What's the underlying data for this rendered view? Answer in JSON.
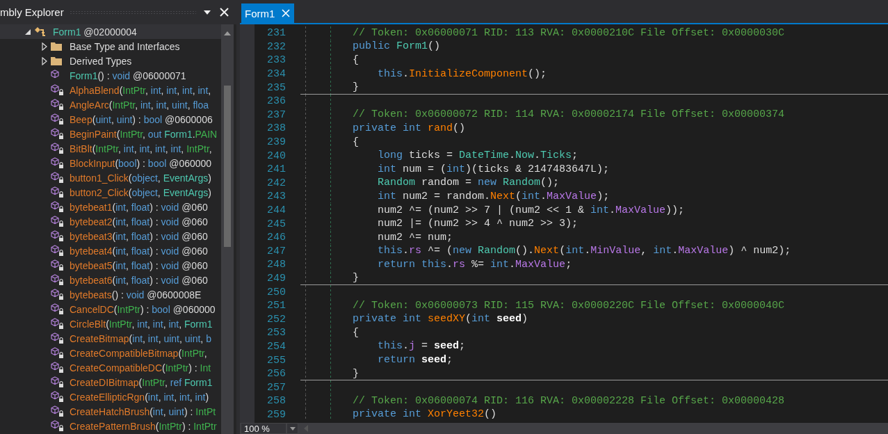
{
  "explorer": {
    "title": "mbly Explorer",
    "tree": [
      {
        "kind": "class",
        "expanded": true,
        "segments": [
          {
            "text": "Form1",
            "kind": "t"
          },
          {
            "text": " @02000004",
            "kind": "p"
          }
        ],
        "children": [
          {
            "kind": "folder",
            "expanded": false,
            "segments": [
              {
                "text": "Base Type and Interfaces",
                "kind": "p"
              }
            ]
          },
          {
            "kind": "folder",
            "expanded": false,
            "segments": [
              {
                "text": "Derived Types",
                "kind": "p"
              }
            ]
          },
          {
            "kind": "method",
            "locked": false,
            "segments": [
              {
                "text": "Form1",
                "kind": "t"
              },
              {
                "text": "() : ",
                "kind": "p"
              },
              {
                "text": "void",
                "kind": "k"
              },
              {
                "text": " @06000071",
                "kind": "p"
              }
            ]
          },
          {
            "kind": "method",
            "locked": true,
            "segments": [
              {
                "text": "AlphaBlend",
                "kind": "m"
              },
              {
                "text": "(",
                "kind": "p"
              },
              {
                "text": "IntPtr",
                "kind": "g"
              },
              {
                "text": ", ",
                "kind": "p"
              },
              {
                "text": "int",
                "kind": "k"
              },
              {
                "text": ", ",
                "kind": "p"
              },
              {
                "text": "int",
                "kind": "k"
              },
              {
                "text": ", ",
                "kind": "p"
              },
              {
                "text": "int",
                "kind": "k"
              },
              {
                "text": ", ",
                "kind": "p"
              },
              {
                "text": "int",
                "kind": "k"
              },
              {
                "text": ",",
                "kind": "p"
              }
            ]
          },
          {
            "kind": "method",
            "locked": true,
            "segments": [
              {
                "text": "AngleArc",
                "kind": "m"
              },
              {
                "text": "(",
                "kind": "p"
              },
              {
                "text": "IntPtr",
                "kind": "g"
              },
              {
                "text": ", ",
                "kind": "p"
              },
              {
                "text": "int",
                "kind": "k"
              },
              {
                "text": ", ",
                "kind": "p"
              },
              {
                "text": "int",
                "kind": "k"
              },
              {
                "text": ", ",
                "kind": "p"
              },
              {
                "text": "uint",
                "kind": "k"
              },
              {
                "text": ", ",
                "kind": "p"
              },
              {
                "text": "floa",
                "kind": "k"
              }
            ]
          },
          {
            "kind": "method",
            "locked": true,
            "segments": [
              {
                "text": "Beep",
                "kind": "m"
              },
              {
                "text": "(",
                "kind": "p"
              },
              {
                "text": "uint",
                "kind": "k"
              },
              {
                "text": ", ",
                "kind": "p"
              },
              {
                "text": "uint",
                "kind": "k"
              },
              {
                "text": ") : ",
                "kind": "p"
              },
              {
                "text": "bool",
                "kind": "k"
              },
              {
                "text": " @0600006",
                "kind": "p"
              }
            ]
          },
          {
            "kind": "method",
            "locked": true,
            "segments": [
              {
                "text": "BeginPaint",
                "kind": "m"
              },
              {
                "text": "(",
                "kind": "p"
              },
              {
                "text": "IntPtr",
                "kind": "g"
              },
              {
                "text": ", ",
                "kind": "p"
              },
              {
                "text": "out",
                "kind": "k"
              },
              {
                "text": " Form1",
                "kind": "t"
              },
              {
                "text": ".",
                "kind": "p"
              },
              {
                "text": "PAIN",
                "kind": "g"
              }
            ]
          },
          {
            "kind": "method",
            "locked": true,
            "segments": [
              {
                "text": "BitBlt",
                "kind": "m"
              },
              {
                "text": "(",
                "kind": "p"
              },
              {
                "text": "IntPtr",
                "kind": "g"
              },
              {
                "text": ", ",
                "kind": "p"
              },
              {
                "text": "int",
                "kind": "k"
              },
              {
                "text": ", ",
                "kind": "p"
              },
              {
                "text": "int",
                "kind": "k"
              },
              {
                "text": ", ",
                "kind": "p"
              },
              {
                "text": "int",
                "kind": "k"
              },
              {
                "text": ", ",
                "kind": "p"
              },
              {
                "text": "int",
                "kind": "k"
              },
              {
                "text": ", ",
                "kind": "p"
              },
              {
                "text": "IntPtr",
                "kind": "g"
              },
              {
                "text": ",",
                "kind": "p"
              }
            ]
          },
          {
            "kind": "method",
            "locked": true,
            "segments": [
              {
                "text": "BlockInput",
                "kind": "m"
              },
              {
                "text": "(",
                "kind": "p"
              },
              {
                "text": "bool",
                "kind": "k"
              },
              {
                "text": ") : ",
                "kind": "p"
              },
              {
                "text": "bool",
                "kind": "k"
              },
              {
                "text": " @060000",
                "kind": "p"
              }
            ]
          },
          {
            "kind": "method",
            "locked": true,
            "segments": [
              {
                "text": "button1_Click",
                "kind": "m"
              },
              {
                "text": "(",
                "kind": "p"
              },
              {
                "text": "object",
                "kind": "k"
              },
              {
                "text": ", ",
                "kind": "p"
              },
              {
                "text": "EventArgs",
                "kind": "t"
              },
              {
                "text": ")",
                "kind": "p"
              }
            ]
          },
          {
            "kind": "method",
            "locked": true,
            "segments": [
              {
                "text": "button2_Click",
                "kind": "m"
              },
              {
                "text": "(",
                "kind": "p"
              },
              {
                "text": "object",
                "kind": "k"
              },
              {
                "text": ", ",
                "kind": "p"
              },
              {
                "text": "EventArgs",
                "kind": "t"
              },
              {
                "text": ")",
                "kind": "p"
              }
            ]
          },
          {
            "kind": "method",
            "locked": true,
            "segments": [
              {
                "text": "bytebeat1",
                "kind": "m"
              },
              {
                "text": "(",
                "kind": "p"
              },
              {
                "text": "int",
                "kind": "k"
              },
              {
                "text": ", ",
                "kind": "p"
              },
              {
                "text": "float",
                "kind": "k"
              },
              {
                "text": ") : ",
                "kind": "p"
              },
              {
                "text": "void",
                "kind": "k"
              },
              {
                "text": " @060",
                "kind": "p"
              }
            ]
          },
          {
            "kind": "method",
            "locked": true,
            "segments": [
              {
                "text": "bytebeat2",
                "kind": "m"
              },
              {
                "text": "(",
                "kind": "p"
              },
              {
                "text": "int",
                "kind": "k"
              },
              {
                "text": ", ",
                "kind": "p"
              },
              {
                "text": "float",
                "kind": "k"
              },
              {
                "text": ") : ",
                "kind": "p"
              },
              {
                "text": "void",
                "kind": "k"
              },
              {
                "text": " @060",
                "kind": "p"
              }
            ]
          },
          {
            "kind": "method",
            "locked": true,
            "segments": [
              {
                "text": "bytebeat3",
                "kind": "m"
              },
              {
                "text": "(",
                "kind": "p"
              },
              {
                "text": "int",
                "kind": "k"
              },
              {
                "text": ", ",
                "kind": "p"
              },
              {
                "text": "float",
                "kind": "k"
              },
              {
                "text": ") : ",
                "kind": "p"
              },
              {
                "text": "void",
                "kind": "k"
              },
              {
                "text": " @060",
                "kind": "p"
              }
            ]
          },
          {
            "kind": "method",
            "locked": true,
            "segments": [
              {
                "text": "bytebeat4",
                "kind": "m"
              },
              {
                "text": "(",
                "kind": "p"
              },
              {
                "text": "int",
                "kind": "k"
              },
              {
                "text": ", ",
                "kind": "p"
              },
              {
                "text": "float",
                "kind": "k"
              },
              {
                "text": ") : ",
                "kind": "p"
              },
              {
                "text": "void",
                "kind": "k"
              },
              {
                "text": " @060",
                "kind": "p"
              }
            ]
          },
          {
            "kind": "method",
            "locked": true,
            "segments": [
              {
                "text": "bytebeat5",
                "kind": "m"
              },
              {
                "text": "(",
                "kind": "p"
              },
              {
                "text": "int",
                "kind": "k"
              },
              {
                "text": ", ",
                "kind": "p"
              },
              {
                "text": "float",
                "kind": "k"
              },
              {
                "text": ") : ",
                "kind": "p"
              },
              {
                "text": "void",
                "kind": "k"
              },
              {
                "text": " @060",
                "kind": "p"
              }
            ]
          },
          {
            "kind": "method",
            "locked": true,
            "segments": [
              {
                "text": "bytebeat6",
                "kind": "m"
              },
              {
                "text": "(",
                "kind": "p"
              },
              {
                "text": "int",
                "kind": "k"
              },
              {
                "text": ", ",
                "kind": "p"
              },
              {
                "text": "float",
                "kind": "k"
              },
              {
                "text": ") : ",
                "kind": "p"
              },
              {
                "text": "void",
                "kind": "k"
              },
              {
                "text": " @060",
                "kind": "p"
              }
            ]
          },
          {
            "kind": "method",
            "locked": true,
            "segments": [
              {
                "text": "bytebeats",
                "kind": "m"
              },
              {
                "text": "() : ",
                "kind": "p"
              },
              {
                "text": "void",
                "kind": "k"
              },
              {
                "text": " @0600008E",
                "kind": "p"
              }
            ]
          },
          {
            "kind": "method",
            "locked": true,
            "segments": [
              {
                "text": "CancelDC",
                "kind": "m"
              },
              {
                "text": "(",
                "kind": "p"
              },
              {
                "text": "IntPtr",
                "kind": "g"
              },
              {
                "text": ") : ",
                "kind": "p"
              },
              {
                "text": "bool",
                "kind": "k"
              },
              {
                "text": " @060000",
                "kind": "p"
              }
            ]
          },
          {
            "kind": "method",
            "locked": true,
            "segments": [
              {
                "text": "CircleBlt",
                "kind": "m"
              },
              {
                "text": "(",
                "kind": "p"
              },
              {
                "text": "IntPtr",
                "kind": "g"
              },
              {
                "text": ", ",
                "kind": "p"
              },
              {
                "text": "int",
                "kind": "k"
              },
              {
                "text": ", ",
                "kind": "p"
              },
              {
                "text": "int",
                "kind": "k"
              },
              {
                "text": ", ",
                "kind": "p"
              },
              {
                "text": "int",
                "kind": "k"
              },
              {
                "text": ", ",
                "kind": "p"
              },
              {
                "text": "Form1",
                "kind": "t"
              }
            ]
          },
          {
            "kind": "method",
            "locked": true,
            "segments": [
              {
                "text": "CreateBitmap",
                "kind": "m"
              },
              {
                "text": "(",
                "kind": "p"
              },
              {
                "text": "int",
                "kind": "k"
              },
              {
                "text": ", ",
                "kind": "p"
              },
              {
                "text": "int",
                "kind": "k"
              },
              {
                "text": ", ",
                "kind": "p"
              },
              {
                "text": "uint",
                "kind": "k"
              },
              {
                "text": ", ",
                "kind": "p"
              },
              {
                "text": "uint",
                "kind": "k"
              },
              {
                "text": ", ",
                "kind": "p"
              },
              {
                "text": "b",
                "kind": "k"
              }
            ]
          },
          {
            "kind": "method",
            "locked": true,
            "segments": [
              {
                "text": "CreateCompatibleBitmap",
                "kind": "m"
              },
              {
                "text": "(",
                "kind": "p"
              },
              {
                "text": "IntPtr",
                "kind": "g"
              },
              {
                "text": ",",
                "kind": "p"
              }
            ]
          },
          {
            "kind": "method",
            "locked": true,
            "segments": [
              {
                "text": "CreateCompatibleDC",
                "kind": "m"
              },
              {
                "text": "(",
                "kind": "p"
              },
              {
                "text": "IntPtr",
                "kind": "g"
              },
              {
                "text": ") : ",
                "kind": "p"
              },
              {
                "text": "Int",
                "kind": "g"
              }
            ]
          },
          {
            "kind": "method",
            "locked": true,
            "segments": [
              {
                "text": "CreateDIBitmap",
                "kind": "m"
              },
              {
                "text": "(",
                "kind": "p"
              },
              {
                "text": "IntPtr",
                "kind": "g"
              },
              {
                "text": ", ",
                "kind": "p"
              },
              {
                "text": "ref",
                "kind": "k"
              },
              {
                "text": " Form1",
                "kind": "t"
              }
            ]
          },
          {
            "kind": "method",
            "locked": true,
            "segments": [
              {
                "text": "CreateEllipticRgn",
                "kind": "m"
              },
              {
                "text": "(",
                "kind": "p"
              },
              {
                "text": "int",
                "kind": "k"
              },
              {
                "text": ", ",
                "kind": "p"
              },
              {
                "text": "int",
                "kind": "k"
              },
              {
                "text": ", ",
                "kind": "p"
              },
              {
                "text": "int",
                "kind": "k"
              },
              {
                "text": ", ",
                "kind": "p"
              },
              {
                "text": "int",
                "kind": "k"
              },
              {
                "text": ")",
                "kind": "p"
              }
            ]
          },
          {
            "kind": "method",
            "locked": true,
            "segments": [
              {
                "text": "CreateHatchBrush",
                "kind": "m"
              },
              {
                "text": "(",
                "kind": "p"
              },
              {
                "text": "int",
                "kind": "k"
              },
              {
                "text": ", ",
                "kind": "p"
              },
              {
                "text": "uint",
                "kind": "k"
              },
              {
                "text": ") : ",
                "kind": "p"
              },
              {
                "text": "IntPt",
                "kind": "g"
              }
            ]
          },
          {
            "kind": "method",
            "locked": true,
            "segments": [
              {
                "text": "CreatePatternBrush",
                "kind": "m"
              },
              {
                "text": "(",
                "kind": "p"
              },
              {
                "text": "IntPtr",
                "kind": "g"
              },
              {
                "text": ") : ",
                "kind": "p"
              },
              {
                "text": "IntPtr",
                "kind": "g"
              }
            ]
          }
        ]
      }
    ]
  },
  "editor": {
    "tabs": [
      {
        "label": "Form1",
        "selected": true
      }
    ],
    "lines": [
      {
        "number": "231",
        "tokens": [
          {
            "text": "// Token: 0x06000071 RID: 113 RVA: 0x0000210C File Offset: 0x0000030C",
            "kind": "c"
          }
        ]
      },
      {
        "number": "232",
        "tokens": [
          {
            "text": "public",
            "kind": "k"
          },
          {
            "text": " Form1",
            "kind": "t"
          },
          {
            "text": "()",
            "kind": "p"
          }
        ]
      },
      {
        "number": "233",
        "tokens": [
          {
            "text": "{",
            "kind": "p"
          }
        ]
      },
      {
        "number": "234",
        "tokens": [
          {
            "text": "    this",
            "kind": "k"
          },
          {
            "text": ".",
            "kind": "p"
          },
          {
            "text": "InitializeComponent",
            "kind": "m"
          },
          {
            "text": "();",
            "kind": "p"
          }
        ]
      },
      {
        "number": "235",
        "divider": true,
        "tokens": [
          {
            "text": "}",
            "kind": "p"
          }
        ]
      },
      {
        "number": "236"
      },
      {
        "number": "237",
        "tokens": [
          {
            "text": "// Token: 0x06000072 RID: 114 RVA: 0x00002174 File Offset: 0x00000374",
            "kind": "c"
          }
        ]
      },
      {
        "number": "238",
        "tokens": [
          {
            "text": "private int",
            "kind": "k"
          },
          {
            "text": " rand",
            "kind": "m"
          },
          {
            "text": "()",
            "kind": "p"
          }
        ]
      },
      {
        "number": "239",
        "tokens": [
          {
            "text": "{",
            "kind": "p"
          }
        ]
      },
      {
        "number": "240",
        "tokens": [
          {
            "text": "    long",
            "kind": "k"
          },
          {
            "text": " ticks = ",
            "kind": "p"
          },
          {
            "text": "DateTime",
            "kind": "t"
          },
          {
            "text": ".",
            "kind": "p"
          },
          {
            "text": "Now",
            "kind": "t"
          },
          {
            "text": ".",
            "kind": "p"
          },
          {
            "text": "Ticks",
            "kind": "t"
          },
          {
            "text": ";",
            "kind": "p"
          }
        ]
      },
      {
        "number": "241",
        "tokens": [
          {
            "text": "    int",
            "kind": "k"
          },
          {
            "text": " num = (",
            "kind": "p"
          },
          {
            "text": "int",
            "kind": "k"
          },
          {
            "text": ")(ticks & 2147483647L);",
            "kind": "p"
          }
        ]
      },
      {
        "number": "242",
        "tokens": [
          {
            "text": "    Random",
            "kind": "t"
          },
          {
            "text": " random = ",
            "kind": "p"
          },
          {
            "text": "new",
            "kind": "k"
          },
          {
            "text": " Random",
            "kind": "t"
          },
          {
            "text": "();",
            "kind": "p"
          }
        ]
      },
      {
        "number": "243",
        "tokens": [
          {
            "text": "    int",
            "kind": "k"
          },
          {
            "text": " num2 = random.",
            "kind": "p"
          },
          {
            "text": "Next",
            "kind": "m"
          },
          {
            "text": "(",
            "kind": "p"
          },
          {
            "text": "int",
            "kind": "k"
          },
          {
            "text": ".",
            "kind": "p"
          },
          {
            "text": "MaxValue",
            "kind": "f"
          },
          {
            "text": ");",
            "kind": "p"
          }
        ]
      },
      {
        "number": "244",
        "tokens": [
          {
            "text": "    num2 ^= (num2 >> 7 | (num2 << 1 & ",
            "kind": "p"
          },
          {
            "text": "int",
            "kind": "k"
          },
          {
            "text": ".",
            "kind": "p"
          },
          {
            "text": "MaxValue",
            "kind": "f"
          },
          {
            "text": "));",
            "kind": "p"
          }
        ]
      },
      {
        "number": "245",
        "tokens": [
          {
            "text": "    num2 |= (num2 >> 4 ^ num2 >> 3);",
            "kind": "p"
          }
        ]
      },
      {
        "number": "246",
        "tokens": [
          {
            "text": "    num2 ^= num;",
            "kind": "p"
          }
        ]
      },
      {
        "number": "247",
        "tokens": [
          {
            "text": "    this",
            "kind": "k"
          },
          {
            "text": ".",
            "kind": "p"
          },
          {
            "text": "rs",
            "kind": "f"
          },
          {
            "text": " ^= (",
            "kind": "p"
          },
          {
            "text": "new",
            "kind": "k"
          },
          {
            "text": " Random",
            "kind": "t"
          },
          {
            "text": "().",
            "kind": "p"
          },
          {
            "text": "Next",
            "kind": "m"
          },
          {
            "text": "(",
            "kind": "p"
          },
          {
            "text": "int",
            "kind": "k"
          },
          {
            "text": ".",
            "kind": "p"
          },
          {
            "text": "MinValue",
            "kind": "f"
          },
          {
            "text": ", ",
            "kind": "p"
          },
          {
            "text": "int",
            "kind": "k"
          },
          {
            "text": ".",
            "kind": "p"
          },
          {
            "text": "MaxValue",
            "kind": "f"
          },
          {
            "text": ") ^ num2);",
            "kind": "p"
          }
        ]
      },
      {
        "number": "248",
        "tokens": [
          {
            "text": "    return this",
            "kind": "k"
          },
          {
            "text": ".",
            "kind": "p"
          },
          {
            "text": "rs",
            "kind": "f"
          },
          {
            "text": " %= ",
            "kind": "p"
          },
          {
            "text": "int",
            "kind": "k"
          },
          {
            "text": ".",
            "kind": "p"
          },
          {
            "text": "MaxValue",
            "kind": "f"
          },
          {
            "text": ";",
            "kind": "p"
          }
        ]
      },
      {
        "number": "249",
        "divider": true,
        "tokens": [
          {
            "text": "}",
            "kind": "p"
          }
        ]
      },
      {
        "number": "250"
      },
      {
        "number": "251",
        "tokens": [
          {
            "text": "// Token: 0x06000073 RID: 115 RVA: 0x0000220C File Offset: 0x0000040C",
            "kind": "c"
          }
        ]
      },
      {
        "number": "252",
        "tokens": [
          {
            "text": "private int",
            "kind": "k"
          },
          {
            "text": " seedXY",
            "kind": "m"
          },
          {
            "text": "(",
            "kind": "p"
          },
          {
            "text": "int",
            "kind": "k"
          },
          {
            "text": " seed",
            "kind": "b"
          },
          {
            "text": ")",
            "kind": "p"
          }
        ]
      },
      {
        "number": "253",
        "tokens": [
          {
            "text": "{",
            "kind": "p"
          }
        ]
      },
      {
        "number": "254",
        "tokens": [
          {
            "text": "    this",
            "kind": "k"
          },
          {
            "text": ".",
            "kind": "p"
          },
          {
            "text": "j",
            "kind": "f"
          },
          {
            "text": " = ",
            "kind": "p"
          },
          {
            "text": "seed",
            "kind": "b"
          },
          {
            "text": ";",
            "kind": "p"
          }
        ]
      },
      {
        "number": "255",
        "tokens": [
          {
            "text": "    return",
            "kind": "k"
          },
          {
            "text": " seed",
            "kind": "b"
          },
          {
            "text": ";",
            "kind": "p"
          }
        ]
      },
      {
        "number": "256",
        "divider": true,
        "tokens": [
          {
            "text": "}",
            "kind": "p"
          }
        ]
      },
      {
        "number": "257"
      },
      {
        "number": "258",
        "tokens": [
          {
            "text": "// Token: 0x06000074 RID: 116 RVA: 0x00002228 File Offset: 0x00000428",
            "kind": "c"
          }
        ]
      },
      {
        "number": "259",
        "tokens": [
          {
            "text": "private int",
            "kind": "k"
          },
          {
            "text": " XorYeet32",
            "kind": "m"
          },
          {
            "text": "()",
            "kind": "p"
          }
        ]
      }
    ],
    "zoom": "100 %"
  }
}
